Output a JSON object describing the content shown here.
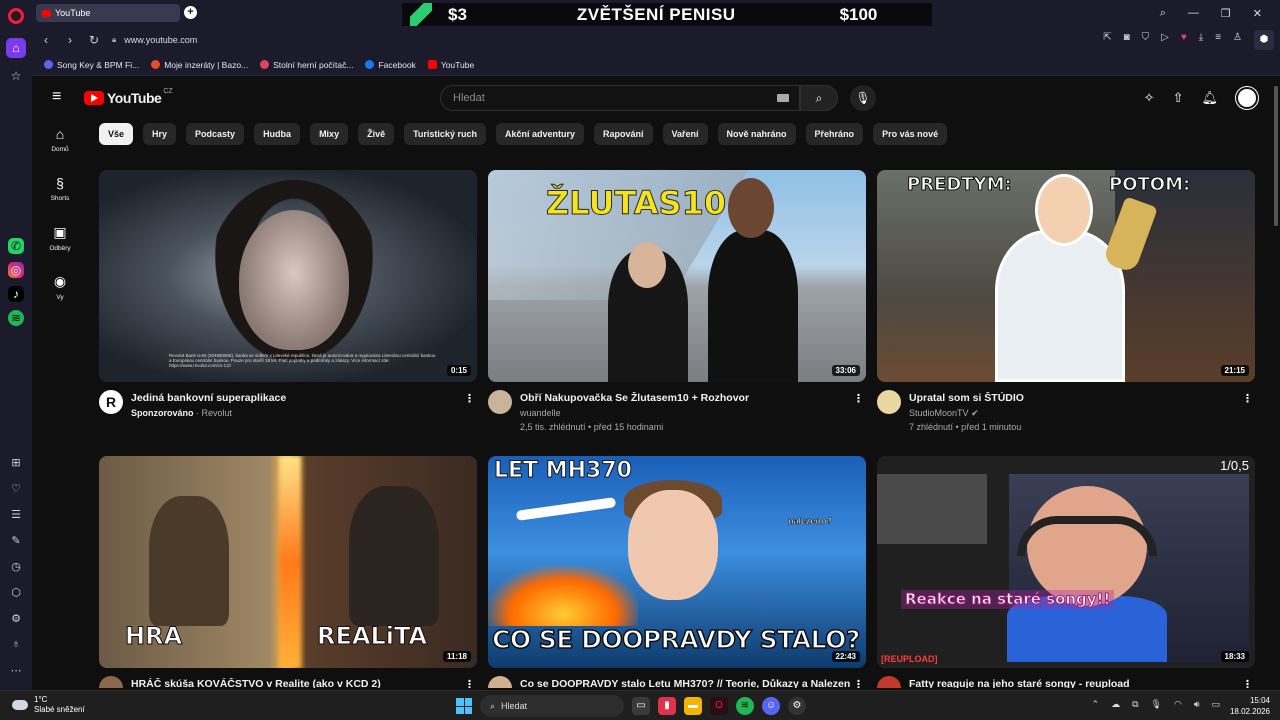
{
  "browser": {
    "tab_title": "YouTube",
    "url": "www.youtube.com",
    "ad": {
      "price_left": "$3",
      "title": "ZVĚTŠENÍ PENISU",
      "price_right": "$100"
    },
    "bookmarks": [
      {
        "label": "Song Key & BPM Fi...",
        "color": "#5865f2"
      },
      {
        "label": "Moje inzeráty | Bazo...",
        "color": "#e44d26"
      },
      {
        "label": "Stolní herní počítač...",
        "color": "#e4405f"
      },
      {
        "label": "Facebook",
        "color": "#1877f2"
      },
      {
        "label": "YouTube",
        "color": "#ff0000"
      }
    ]
  },
  "youtube": {
    "logo_text": "YouTube",
    "country": "CZ",
    "search_placeholder": "Hledat",
    "guide": [
      {
        "label": "Domů",
        "icon": "⌂"
      },
      {
        "label": "Shorts",
        "icon": "§"
      },
      {
        "label": "Odběry",
        "icon": "▣"
      },
      {
        "label": "Vy",
        "icon": "◉"
      }
    ],
    "chips": [
      "Vše",
      "Hry",
      "Podcasty",
      "Hudba",
      "Mixy",
      "Živě",
      "Turistický ruch",
      "Akční adventury",
      "Rapování",
      "Vaření",
      "Nově nahráno",
      "Přehráno",
      "Pro vás nové"
    ],
    "videos": [
      {
        "title": "Jediná bankovní superaplikace",
        "channel": "Sponzorováno",
        "channel2": "Revolut",
        "stats": "",
        "duration": "0:15",
        "avatar": "#ffffff",
        "fine_print": "Revolut Bank UAB (304580906), banka se sídlem v Litevské republice, která je autorizována a regulována Litevskou centrální bankou a Evropskou centrální bankou. Pouze pro starší 18 let. Platí poplatky a podmínky a zákazy. Více informací zde: https://www.revolut.com/cs-CZ/"
      },
      {
        "title": "Obří Nakupovačka Se Žlutasem10 + Rozhovor",
        "channel": "wuandelle",
        "channel2": "",
        "stats": "2,5 tis. zhlédnutí • před 15 hodinami",
        "duration": "33:06",
        "avatar": "#c9b39a",
        "overlay": "ŽLUTAS10"
      },
      {
        "title": "Upratal som si ŠTÚDIO",
        "channel": "StudioMoonTV",
        "channel2": "",
        "stats": "7 zhlédnutí • před 1 minutou",
        "duration": "21:15",
        "avatar": "#e8d7a0",
        "overlay_left": "PREDTYM:",
        "overlay_right": "POTOM:"
      },
      {
        "title": "HRÁČ skúša KOVÁČSTVO v Realite (ako v KCD 2)",
        "channel": "",
        "channel2": "",
        "stats": "",
        "duration": "11:18",
        "avatar": "#8a6a4a",
        "overlay_left": "HRA",
        "overlay_right": "REALiTA"
      },
      {
        "title": "Co se DOOPRAVDY stalo Letu MH370? // Teorie, Důkazy a Nalezení",
        "channel": "",
        "channel2": "",
        "stats": "",
        "duration": "22:43",
        "avatar": "#d0b090",
        "overlay_top": "LET MH370",
        "overlay_bottom": "CO SE DOOPRAVDY STALO?",
        "overlay_tag": "nalezeno?"
      },
      {
        "title": "Fatty reaguje na jeho staré songy - reupload",
        "channel": "",
        "channel2": "",
        "stats": "",
        "duration": "18:33",
        "avatar": "#c0392b",
        "overlay_caption": "Reakce na staré songy!!",
        "overlay_reup": "[REUPLOAD]",
        "overlay_counter": "1/0,5"
      }
    ]
  },
  "taskbar": {
    "weather_temp": "1°C",
    "weather_desc": "Slabé sněžení",
    "search_label": "Hledat",
    "time": "15:04",
    "date": "18.02.2026"
  }
}
